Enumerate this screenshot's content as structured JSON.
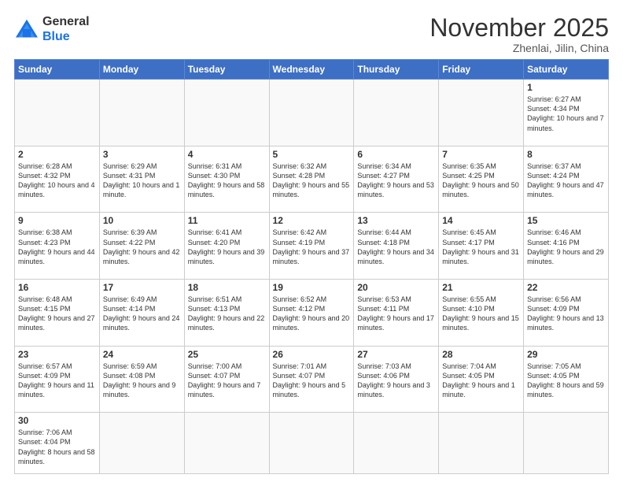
{
  "logo": {
    "line1": "General",
    "line2": "Blue"
  },
  "header": {
    "month": "November 2025",
    "location": "Zhenlai, Jilin, China"
  },
  "days": [
    "Sunday",
    "Monday",
    "Tuesday",
    "Wednesday",
    "Thursday",
    "Friday",
    "Saturday"
  ],
  "weeks": [
    [
      {
        "day": "",
        "info": ""
      },
      {
        "day": "",
        "info": ""
      },
      {
        "day": "",
        "info": ""
      },
      {
        "day": "",
        "info": ""
      },
      {
        "day": "",
        "info": ""
      },
      {
        "day": "",
        "info": ""
      },
      {
        "day": "1",
        "info": "Sunrise: 6:27 AM\nSunset: 4:34 PM\nDaylight: 10 hours and 7 minutes."
      }
    ],
    [
      {
        "day": "2",
        "info": "Sunrise: 6:28 AM\nSunset: 4:32 PM\nDaylight: 10 hours and 4 minutes."
      },
      {
        "day": "3",
        "info": "Sunrise: 6:29 AM\nSunset: 4:31 PM\nDaylight: 10 hours and 1 minute."
      },
      {
        "day": "4",
        "info": "Sunrise: 6:31 AM\nSunset: 4:30 PM\nDaylight: 9 hours and 58 minutes."
      },
      {
        "day": "5",
        "info": "Sunrise: 6:32 AM\nSunset: 4:28 PM\nDaylight: 9 hours and 55 minutes."
      },
      {
        "day": "6",
        "info": "Sunrise: 6:34 AM\nSunset: 4:27 PM\nDaylight: 9 hours and 53 minutes."
      },
      {
        "day": "7",
        "info": "Sunrise: 6:35 AM\nSunset: 4:25 PM\nDaylight: 9 hours and 50 minutes."
      },
      {
        "day": "8",
        "info": "Sunrise: 6:37 AM\nSunset: 4:24 PM\nDaylight: 9 hours and 47 minutes."
      }
    ],
    [
      {
        "day": "9",
        "info": "Sunrise: 6:38 AM\nSunset: 4:23 PM\nDaylight: 9 hours and 44 minutes."
      },
      {
        "day": "10",
        "info": "Sunrise: 6:39 AM\nSunset: 4:22 PM\nDaylight: 9 hours and 42 minutes."
      },
      {
        "day": "11",
        "info": "Sunrise: 6:41 AM\nSunset: 4:20 PM\nDaylight: 9 hours and 39 minutes."
      },
      {
        "day": "12",
        "info": "Sunrise: 6:42 AM\nSunset: 4:19 PM\nDaylight: 9 hours and 37 minutes."
      },
      {
        "day": "13",
        "info": "Sunrise: 6:44 AM\nSunset: 4:18 PM\nDaylight: 9 hours and 34 minutes."
      },
      {
        "day": "14",
        "info": "Sunrise: 6:45 AM\nSunset: 4:17 PM\nDaylight: 9 hours and 31 minutes."
      },
      {
        "day": "15",
        "info": "Sunrise: 6:46 AM\nSunset: 4:16 PM\nDaylight: 9 hours and 29 minutes."
      }
    ],
    [
      {
        "day": "16",
        "info": "Sunrise: 6:48 AM\nSunset: 4:15 PM\nDaylight: 9 hours and 27 minutes."
      },
      {
        "day": "17",
        "info": "Sunrise: 6:49 AM\nSunset: 4:14 PM\nDaylight: 9 hours and 24 minutes."
      },
      {
        "day": "18",
        "info": "Sunrise: 6:51 AM\nSunset: 4:13 PM\nDaylight: 9 hours and 22 minutes."
      },
      {
        "day": "19",
        "info": "Sunrise: 6:52 AM\nSunset: 4:12 PM\nDaylight: 9 hours and 20 minutes."
      },
      {
        "day": "20",
        "info": "Sunrise: 6:53 AM\nSunset: 4:11 PM\nDaylight: 9 hours and 17 minutes."
      },
      {
        "day": "21",
        "info": "Sunrise: 6:55 AM\nSunset: 4:10 PM\nDaylight: 9 hours and 15 minutes."
      },
      {
        "day": "22",
        "info": "Sunrise: 6:56 AM\nSunset: 4:09 PM\nDaylight: 9 hours and 13 minutes."
      }
    ],
    [
      {
        "day": "23",
        "info": "Sunrise: 6:57 AM\nSunset: 4:09 PM\nDaylight: 9 hours and 11 minutes."
      },
      {
        "day": "24",
        "info": "Sunrise: 6:59 AM\nSunset: 4:08 PM\nDaylight: 9 hours and 9 minutes."
      },
      {
        "day": "25",
        "info": "Sunrise: 7:00 AM\nSunset: 4:07 PM\nDaylight: 9 hours and 7 minutes."
      },
      {
        "day": "26",
        "info": "Sunrise: 7:01 AM\nSunset: 4:07 PM\nDaylight: 9 hours and 5 minutes."
      },
      {
        "day": "27",
        "info": "Sunrise: 7:03 AM\nSunset: 4:06 PM\nDaylight: 9 hours and 3 minutes."
      },
      {
        "day": "28",
        "info": "Sunrise: 7:04 AM\nSunset: 4:05 PM\nDaylight: 9 hours and 1 minute."
      },
      {
        "day": "29",
        "info": "Sunrise: 7:05 AM\nSunset: 4:05 PM\nDaylight: 8 hours and 59 minutes."
      }
    ],
    [
      {
        "day": "30",
        "info": "Sunrise: 7:06 AM\nSunset: 4:04 PM\nDaylight: 8 hours and 58 minutes."
      },
      {
        "day": "",
        "info": ""
      },
      {
        "day": "",
        "info": ""
      },
      {
        "day": "",
        "info": ""
      },
      {
        "day": "",
        "info": ""
      },
      {
        "day": "",
        "info": ""
      },
      {
        "day": "",
        "info": ""
      }
    ]
  ]
}
